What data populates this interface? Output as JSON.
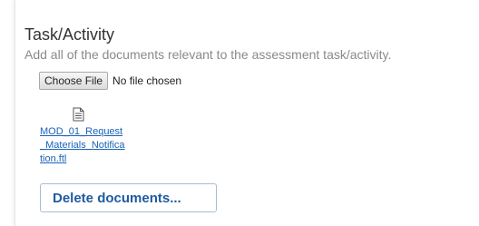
{
  "section": {
    "title": "Task/Activity",
    "description": "Add all of the documents relevant to the assessment task/activity."
  },
  "file_input": {
    "button_label": "Choose File",
    "status": "No file chosen"
  },
  "documents": [
    {
      "icon": "document-icon",
      "name": "MOD_01_Request_Materials_Notification.ftl"
    }
  ],
  "actions": {
    "delete_label": "Delete documents..."
  },
  "colors": {
    "link": "#1a62b8",
    "delete_button_text": "#1f5ba0",
    "description_text": "#8a8a8a"
  }
}
